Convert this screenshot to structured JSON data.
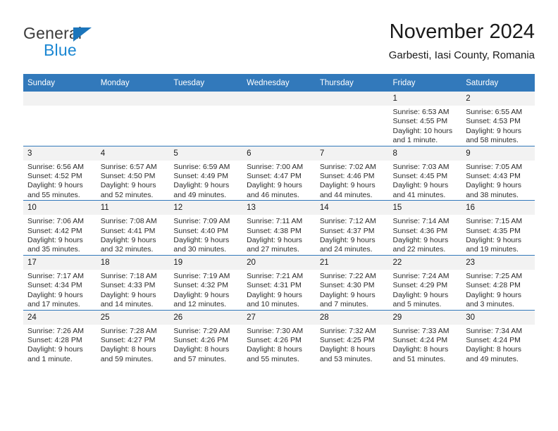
{
  "brand": {
    "name_top": "General",
    "name_bottom": "Blue",
    "triangle_icon": "brand-triangle-icon",
    "accent_color": "#1b87d2"
  },
  "header": {
    "title": "November 2024",
    "subtitle": "Garbesti, Iasi County, Romania"
  },
  "calendar": {
    "header_bg": "#3279bb",
    "daynum_bg": "#f2f2f2",
    "weekdays": [
      "Sunday",
      "Monday",
      "Tuesday",
      "Wednesday",
      "Thursday",
      "Friday",
      "Saturday"
    ],
    "weeks": [
      [
        {
          "day": "",
          "empty": true
        },
        {
          "day": "",
          "empty": true
        },
        {
          "day": "",
          "empty": true
        },
        {
          "day": "",
          "empty": true
        },
        {
          "day": "",
          "empty": true
        },
        {
          "day": "1",
          "sunrise": "Sunrise: 6:53 AM",
          "sunset": "Sunset: 4:55 PM",
          "daylight": "Daylight: 10 hours and 1 minute."
        },
        {
          "day": "2",
          "sunrise": "Sunrise: 6:55 AM",
          "sunset": "Sunset: 4:53 PM",
          "daylight": "Daylight: 9 hours and 58 minutes."
        }
      ],
      [
        {
          "day": "3",
          "sunrise": "Sunrise: 6:56 AM",
          "sunset": "Sunset: 4:52 PM",
          "daylight": "Daylight: 9 hours and 55 minutes."
        },
        {
          "day": "4",
          "sunrise": "Sunrise: 6:57 AM",
          "sunset": "Sunset: 4:50 PM",
          "daylight": "Daylight: 9 hours and 52 minutes."
        },
        {
          "day": "5",
          "sunrise": "Sunrise: 6:59 AM",
          "sunset": "Sunset: 4:49 PM",
          "daylight": "Daylight: 9 hours and 49 minutes."
        },
        {
          "day": "6",
          "sunrise": "Sunrise: 7:00 AM",
          "sunset": "Sunset: 4:47 PM",
          "daylight": "Daylight: 9 hours and 46 minutes."
        },
        {
          "day": "7",
          "sunrise": "Sunrise: 7:02 AM",
          "sunset": "Sunset: 4:46 PM",
          "daylight": "Daylight: 9 hours and 44 minutes."
        },
        {
          "day": "8",
          "sunrise": "Sunrise: 7:03 AM",
          "sunset": "Sunset: 4:45 PM",
          "daylight": "Daylight: 9 hours and 41 minutes."
        },
        {
          "day": "9",
          "sunrise": "Sunrise: 7:05 AM",
          "sunset": "Sunset: 4:43 PM",
          "daylight": "Daylight: 9 hours and 38 minutes."
        }
      ],
      [
        {
          "day": "10",
          "sunrise": "Sunrise: 7:06 AM",
          "sunset": "Sunset: 4:42 PM",
          "daylight": "Daylight: 9 hours and 35 minutes."
        },
        {
          "day": "11",
          "sunrise": "Sunrise: 7:08 AM",
          "sunset": "Sunset: 4:41 PM",
          "daylight": "Daylight: 9 hours and 32 minutes."
        },
        {
          "day": "12",
          "sunrise": "Sunrise: 7:09 AM",
          "sunset": "Sunset: 4:40 PM",
          "daylight": "Daylight: 9 hours and 30 minutes."
        },
        {
          "day": "13",
          "sunrise": "Sunrise: 7:11 AM",
          "sunset": "Sunset: 4:38 PM",
          "daylight": "Daylight: 9 hours and 27 minutes."
        },
        {
          "day": "14",
          "sunrise": "Sunrise: 7:12 AM",
          "sunset": "Sunset: 4:37 PM",
          "daylight": "Daylight: 9 hours and 24 minutes."
        },
        {
          "day": "15",
          "sunrise": "Sunrise: 7:14 AM",
          "sunset": "Sunset: 4:36 PM",
          "daylight": "Daylight: 9 hours and 22 minutes."
        },
        {
          "day": "16",
          "sunrise": "Sunrise: 7:15 AM",
          "sunset": "Sunset: 4:35 PM",
          "daylight": "Daylight: 9 hours and 19 minutes."
        }
      ],
      [
        {
          "day": "17",
          "sunrise": "Sunrise: 7:17 AM",
          "sunset": "Sunset: 4:34 PM",
          "daylight": "Daylight: 9 hours and 17 minutes."
        },
        {
          "day": "18",
          "sunrise": "Sunrise: 7:18 AM",
          "sunset": "Sunset: 4:33 PM",
          "daylight": "Daylight: 9 hours and 14 minutes."
        },
        {
          "day": "19",
          "sunrise": "Sunrise: 7:19 AM",
          "sunset": "Sunset: 4:32 PM",
          "daylight": "Daylight: 9 hours and 12 minutes."
        },
        {
          "day": "20",
          "sunrise": "Sunrise: 7:21 AM",
          "sunset": "Sunset: 4:31 PM",
          "daylight": "Daylight: 9 hours and 10 minutes."
        },
        {
          "day": "21",
          "sunrise": "Sunrise: 7:22 AM",
          "sunset": "Sunset: 4:30 PM",
          "daylight": "Daylight: 9 hours and 7 minutes."
        },
        {
          "day": "22",
          "sunrise": "Sunrise: 7:24 AM",
          "sunset": "Sunset: 4:29 PM",
          "daylight": "Daylight: 9 hours and 5 minutes."
        },
        {
          "day": "23",
          "sunrise": "Sunrise: 7:25 AM",
          "sunset": "Sunset: 4:28 PM",
          "daylight": "Daylight: 9 hours and 3 minutes."
        }
      ],
      [
        {
          "day": "24",
          "sunrise": "Sunrise: 7:26 AM",
          "sunset": "Sunset: 4:28 PM",
          "daylight": "Daylight: 9 hours and 1 minute."
        },
        {
          "day": "25",
          "sunrise": "Sunrise: 7:28 AM",
          "sunset": "Sunset: 4:27 PM",
          "daylight": "Daylight: 8 hours and 59 minutes."
        },
        {
          "day": "26",
          "sunrise": "Sunrise: 7:29 AM",
          "sunset": "Sunset: 4:26 PM",
          "daylight": "Daylight: 8 hours and 57 minutes."
        },
        {
          "day": "27",
          "sunrise": "Sunrise: 7:30 AM",
          "sunset": "Sunset: 4:26 PM",
          "daylight": "Daylight: 8 hours and 55 minutes."
        },
        {
          "day": "28",
          "sunrise": "Sunrise: 7:32 AM",
          "sunset": "Sunset: 4:25 PM",
          "daylight": "Daylight: 8 hours and 53 minutes."
        },
        {
          "day": "29",
          "sunrise": "Sunrise: 7:33 AM",
          "sunset": "Sunset: 4:24 PM",
          "daylight": "Daylight: 8 hours and 51 minutes."
        },
        {
          "day": "30",
          "sunrise": "Sunrise: 7:34 AM",
          "sunset": "Sunset: 4:24 PM",
          "daylight": "Daylight: 8 hours and 49 minutes."
        }
      ]
    ]
  }
}
